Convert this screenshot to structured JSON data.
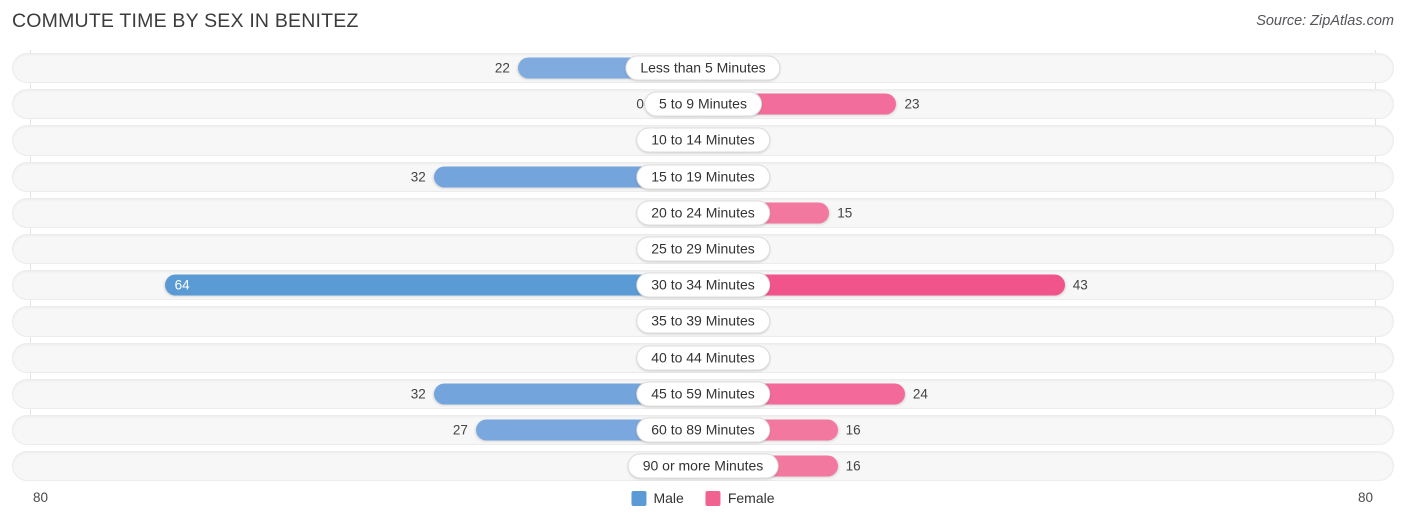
{
  "header": {
    "title": "COMMUTE TIME BY SEX IN BENITEZ",
    "source": "Source: ZipAtlas.com"
  },
  "axis": {
    "left_label": "80",
    "right_label": "80",
    "max": 80
  },
  "legend": {
    "male": "Male",
    "female": "Female",
    "male_color": "#5b9bd5",
    "female_color": "#f0628f"
  },
  "chart_data": {
    "type": "bar",
    "title": "COMMUTE TIME BY SEX IN BENITEZ",
    "orientation": "horizontal-diverging",
    "xlabel": "",
    "ylabel": "",
    "xlim": [
      -80,
      80
    ],
    "grid": true,
    "legend_position": "bottom-center",
    "categories": [
      "Less than 5 Minutes",
      "5 to 9 Minutes",
      "10 to 14 Minutes",
      "15 to 19 Minutes",
      "20 to 24 Minutes",
      "25 to 29 Minutes",
      "30 to 34 Minutes",
      "35 to 39 Minutes",
      "40 to 44 Minutes",
      "45 to 59 Minutes",
      "60 to 89 Minutes",
      "90 or more Minutes"
    ],
    "series": [
      {
        "name": "Male",
        "values": [
          22,
          0,
          0,
          32,
          0,
          0,
          64,
          0,
          0,
          32,
          27,
          0
        ]
      },
      {
        "name": "Female",
        "values": [
          0,
          23,
          0,
          0,
          15,
          0,
          43,
          0,
          0,
          24,
          16,
          16
        ]
      }
    ]
  },
  "rows": [
    {
      "label": "Less than 5 Minutes",
      "male": "22",
      "female": "0",
      "male_v": 22,
      "female_v": 0,
      "male_color": "#7fabdf",
      "female_color": "#f7a0c0",
      "male_inside": false,
      "female_inside": false
    },
    {
      "label": "5 to 9 Minutes",
      "male": "0",
      "female": "23",
      "male_v": 0,
      "female_v": 23,
      "male_color": "#a7c7e9",
      "female_color": "#f26d9c",
      "male_inside": false,
      "female_inside": false
    },
    {
      "label": "10 to 14 Minutes",
      "male": "0",
      "female": "0",
      "male_v": 0,
      "female_v": 0,
      "male_color": "#a7c7e9",
      "female_color": "#f5a0bd",
      "male_inside": false,
      "female_inside": false
    },
    {
      "label": "15 to 19 Minutes",
      "male": "32",
      "female": "0",
      "male_v": 32,
      "female_v": 0,
      "male_color": "#74a4dc",
      "female_color": "#f5a0bd",
      "male_inside": false,
      "female_inside": false
    },
    {
      "label": "20 to 24 Minutes",
      "male": "0",
      "female": "15",
      "male_v": 0,
      "female_v": 15,
      "male_color": "#a7c7e9",
      "female_color": "#f3789f",
      "male_inside": false,
      "female_inside": false
    },
    {
      "label": "25 to 29 Minutes",
      "male": "0",
      "female": "0",
      "male_v": 0,
      "female_v": 0,
      "male_color": "#a7c7e9",
      "female_color": "#f5a0bd",
      "male_inside": false,
      "female_inside": false
    },
    {
      "label": "30 to 34 Minutes",
      "male": "64",
      "female": "43",
      "male_v": 64,
      "female_v": 43,
      "male_color": "#5b9bd5",
      "female_color": "#f0548b",
      "male_inside": true,
      "female_inside": false
    },
    {
      "label": "35 to 39 Minutes",
      "male": "0",
      "female": "0",
      "male_v": 0,
      "female_v": 0,
      "male_color": "#a7c7e9",
      "female_color": "#f5a0bd",
      "male_inside": false,
      "female_inside": false
    },
    {
      "label": "40 to 44 Minutes",
      "male": "0",
      "female": "0",
      "male_v": 0,
      "female_v": 0,
      "male_color": "#a7c7e9",
      "female_color": "#f5a0bd",
      "male_inside": false,
      "female_inside": false
    },
    {
      "label": "45 to 59 Minutes",
      "male": "32",
      "female": "24",
      "male_v": 32,
      "female_v": 24,
      "male_color": "#74a4dc",
      "female_color": "#f2699a",
      "male_inside": false,
      "female_inside": false
    },
    {
      "label": "60 to 89 Minutes",
      "male": "27",
      "female": "16",
      "male_v": 27,
      "female_v": 16,
      "male_color": "#7aa8de",
      "female_color": "#f3789f",
      "male_inside": false,
      "female_inside": false
    },
    {
      "label": "90 or more Minutes",
      "male": "0",
      "female": "16",
      "male_v": 0,
      "female_v": 16,
      "male_color": "#a7c7e9",
      "female_color": "#f3789f",
      "male_inside": false,
      "female_inside": false
    }
  ]
}
